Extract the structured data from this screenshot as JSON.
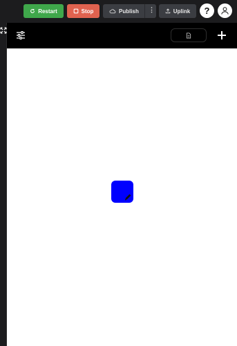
{
  "toolbar": {
    "restart_label": "Restart",
    "stop_label": "Stop",
    "publish_label": "Publish",
    "uplink_label": "Uplink",
    "help_label": "?",
    "icons": {
      "restart": "refresh-icon",
      "stop": "square-stop-icon",
      "publish": "cloud-upload-icon",
      "more": "vertical-dots-icon",
      "uplink": "upload-icon",
      "account": "person-icon"
    }
  },
  "app": {
    "icons": {
      "filter": "sliders-icon",
      "document": "document-icon",
      "add": "plus-icon",
      "expand": "expand-icon",
      "tile": "pen-icon"
    }
  },
  "colors": {
    "restart": "#3fa74b",
    "stop": "#e0624f",
    "tile": "#0000ff"
  }
}
